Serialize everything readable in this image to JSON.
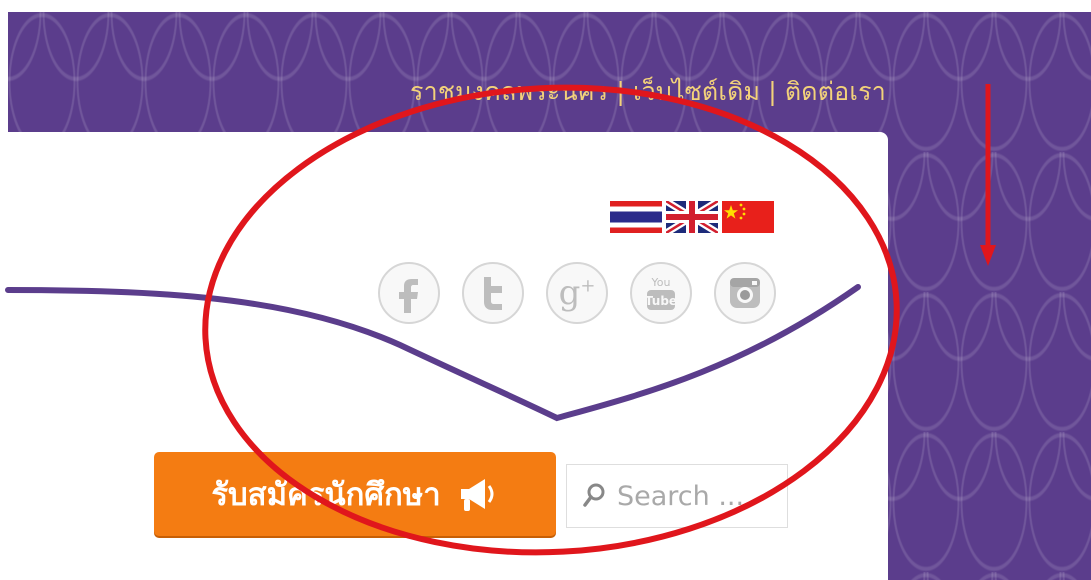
{
  "header": {
    "nav_links": [
      "ราชมงคลพระนคร",
      "เว็บไซต์เดิม",
      "ติดต่อเรา"
    ],
    "separator": "|"
  },
  "colors": {
    "brand_purple": "#5b3d8c",
    "nav_text": "#f3d27a",
    "register_orange": "#f47c12",
    "annotation_red": "#e0161c"
  },
  "languages": [
    {
      "icon": "thailand-flag-icon"
    },
    {
      "icon": "uk-flag-icon"
    },
    {
      "icon": "china-flag-icon"
    }
  ],
  "social": [
    {
      "icon": "facebook-icon",
      "glyph": "f"
    },
    {
      "icon": "twitter-icon",
      "glyph": "t"
    },
    {
      "icon": "google-plus-icon",
      "glyph": "g+"
    },
    {
      "icon": "youtube-icon",
      "glyph": "You Tube"
    },
    {
      "icon": "instagram-icon",
      "glyph": ""
    }
  ],
  "register": {
    "label": "รับสมัครนักศึกษา",
    "icon": "megaphone-icon"
  },
  "search": {
    "placeholder": "Search ..."
  }
}
